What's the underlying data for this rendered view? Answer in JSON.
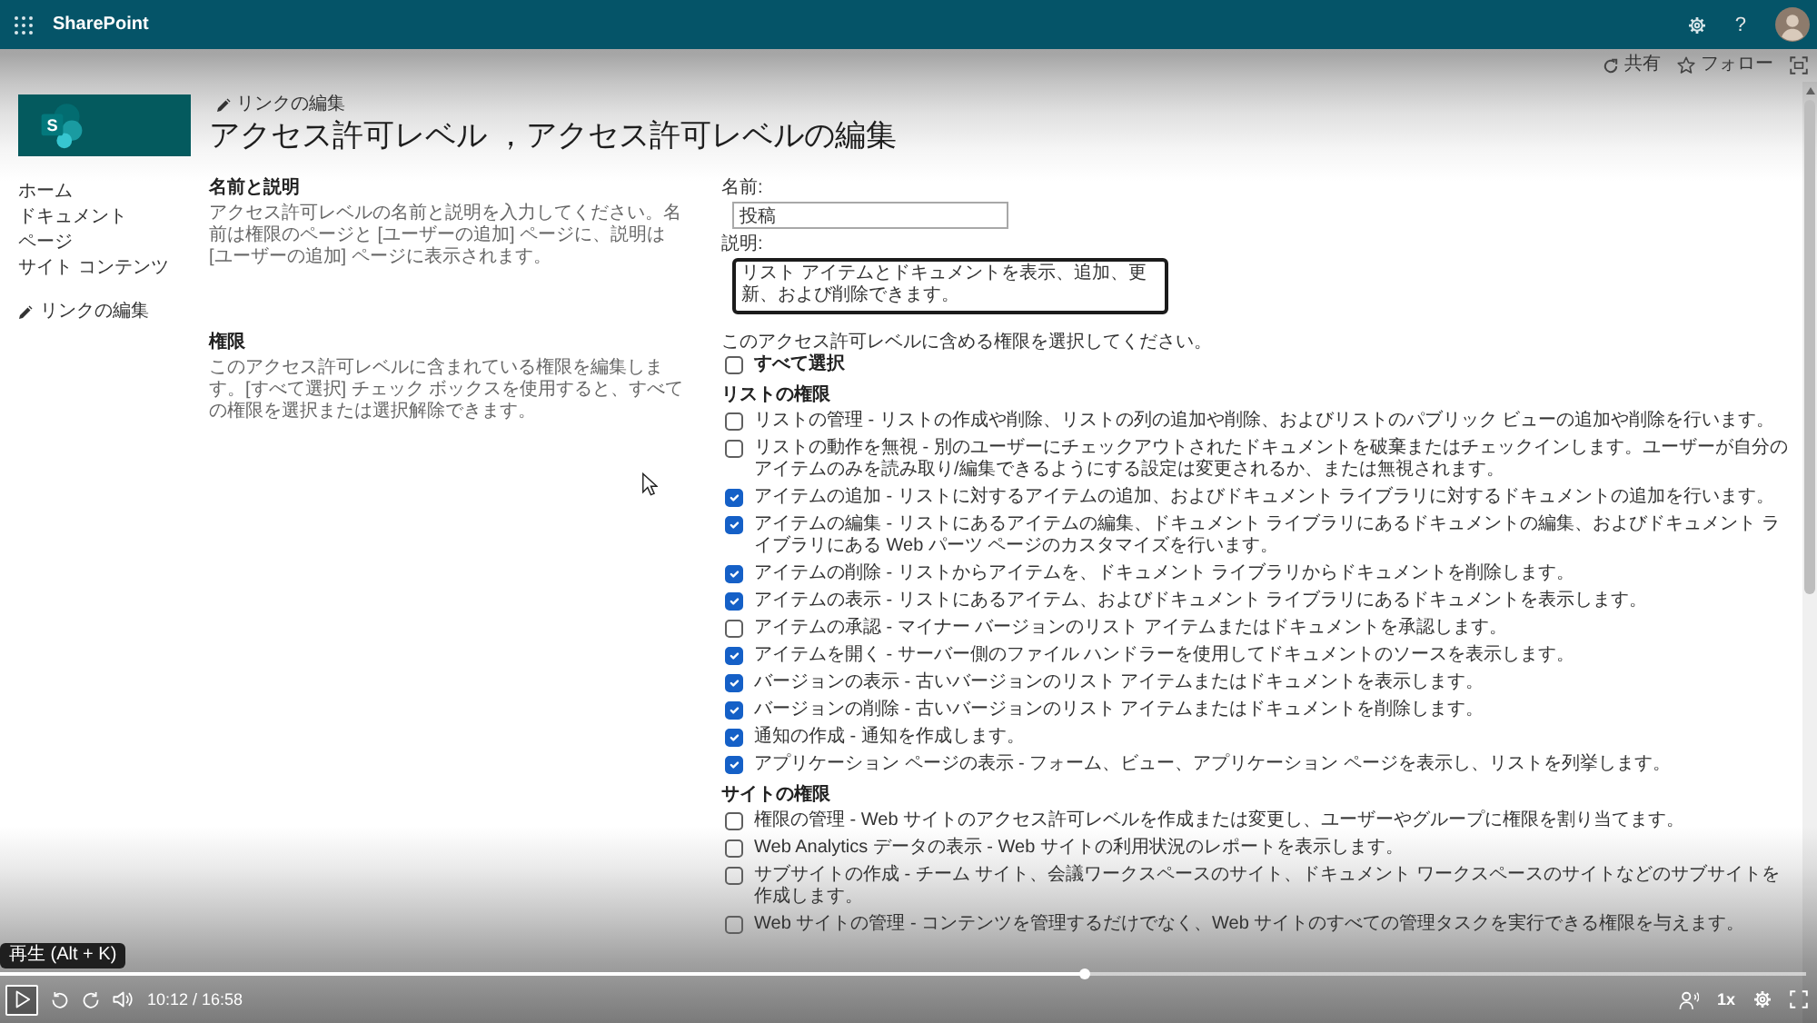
{
  "suite_bar": {
    "app_title": "SharePoint",
    "help_label": "?"
  },
  "command_bar": {
    "actions": [
      {
        "kind": "share",
        "label": "共有"
      },
      {
        "kind": "follow",
        "label": "フォロー"
      }
    ]
  },
  "site_header": {
    "logo_letter": "S",
    "edit_link": "リンクの編集",
    "title": "アクセス許可レベル ，アクセス許可レベルの編集"
  },
  "nav": {
    "items": [
      {
        "label": "ホーム"
      },
      {
        "label": "ドキュメント"
      },
      {
        "label": "ページ"
      },
      {
        "label": "サイト コンテンツ"
      }
    ],
    "edit_link": "リンクの編集"
  },
  "name_section": {
    "heading": "名前と説明",
    "description": "アクセス許可レベルの名前と説明を入力してください。名前は権限のページと [ユーザーの追加] ページに、説明は [ユーザーの追加] ページに表示されます。",
    "name_label": "名前:",
    "name_value": "投稿",
    "description_label": "説明:",
    "description_value": "リスト アイテムとドキュメントを表示、追加、更新、および削除できます。"
  },
  "permissions_section": {
    "heading": "権限",
    "description": "このアクセス許可レベルに含まれている権限を編集します。[すべて選択] チェック ボックスを使用すると、すべての権限を選択または選択解除できます。",
    "instruction": "このアクセス許可レベルに含める権限を選択してください。",
    "select_all": {
      "label": "すべて選択",
      "checked": false
    },
    "groups": [
      {
        "heading": "リストの権限",
        "items": [
          {
            "text": "リストの管理 - リストの作成や削除、リストの列の追加や削除、およびリストのパブリック ビューの追加や削除を行います。",
            "checked": false
          },
          {
            "text": "リストの動作を無視 - 別のユーザーにチェックアウトされたドキュメントを破棄またはチェックインします。ユーザーが自分のアイテムのみを読み取り/編集できるようにする設定は変更されるか、または無視されます。",
            "checked": false
          },
          {
            "text": "アイテムの追加 - リストに対するアイテムの追加、およびドキュメント ライブラリに対するドキュメントの追加を行います。",
            "checked": true
          },
          {
            "text": "アイテムの編集 - リストにあるアイテムの編集、ドキュメント ライブラリにあるドキュメントの編集、およびドキュメント ライブラリにある Web パーツ ページのカスタマイズを行います。",
            "checked": true
          },
          {
            "text": "アイテムの削除 - リストからアイテムを、ドキュメント ライブラリからドキュメントを削除します。",
            "checked": true
          },
          {
            "text": "アイテムの表示 - リストにあるアイテム、およびドキュメント ライブラリにあるドキュメントを表示します。",
            "checked": true
          },
          {
            "text": "アイテムの承認 - マイナー バージョンのリスト アイテムまたはドキュメントを承認します。",
            "checked": false
          },
          {
            "text": "アイテムを開く - サーバー側のファイル ハンドラーを使用してドキュメントのソースを表示します。",
            "checked": true
          },
          {
            "text": "バージョンの表示 - 古いバージョンのリスト アイテムまたはドキュメントを表示します。",
            "checked": true
          },
          {
            "text": "バージョンの削除 - 古いバージョンのリスト アイテムまたはドキュメントを削除します。",
            "checked": true
          },
          {
            "text": "通知の作成 - 通知を作成します。",
            "checked": true
          },
          {
            "text": "アプリケーション ページの表示 - フォーム、ビュー、アプリケーション ページを表示し、リストを列挙します。",
            "checked": true
          }
        ]
      },
      {
        "heading": "サイトの権限",
        "items": [
          {
            "text": "権限の管理 - Web サイトのアクセス許可レベルを作成または変更し、ユーザーやグループに権限を割り当てます。",
            "checked": false
          },
          {
            "text": "Web Analytics データの表示 - Web サイトの利用状況のレポートを表示します。",
            "checked": false
          },
          {
            "text": "サブサイトの作成 - チーム サイト、会議ワークスペースのサイト、ドキュメント ワークスペースのサイトなどのサブサイトを作成します。",
            "checked": false
          },
          {
            "text": "Web サイトの管理 - コンテンツを管理するだけでなく、Web サイトのすべての管理タスクを実行できる権限を与えます。",
            "checked": false
          }
        ]
      }
    ]
  },
  "player": {
    "tooltip": "再生 (Alt + K)",
    "time": "10:12 / 16:58",
    "speed": "1x",
    "level": 0.601
  }
}
